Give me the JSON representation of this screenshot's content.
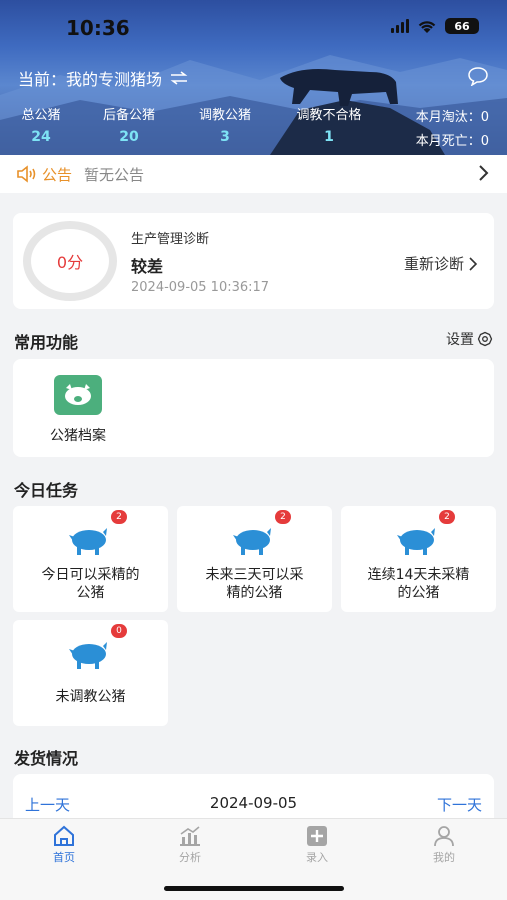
{
  "status": {
    "time": "10:36",
    "battery": "66"
  },
  "header": {
    "farm_prefix": "当前：",
    "farm_name": "我的专测猪场"
  },
  "stats": [
    {
      "label": "总公猪",
      "value": "24"
    },
    {
      "label": "后备公猪",
      "value": "20"
    },
    {
      "label": "调教公猪",
      "value": "3"
    },
    {
      "label": "调教不合格",
      "value": "1"
    }
  ],
  "month": {
    "culled": "本月淘汰：0",
    "dead": "本月死亡：0"
  },
  "notice": {
    "tag": "公告",
    "text": "暂无公告"
  },
  "diagnosis": {
    "score": "0分",
    "title": "生产管理诊断",
    "level": "较差",
    "time": "2024-09-05 10:36:17",
    "action": "重新诊断"
  },
  "common": {
    "title": "常用功能",
    "setting": "设置",
    "items": [
      {
        "label": "公猪档案"
      }
    ]
  },
  "tasks": {
    "title": "今日任务",
    "items": [
      {
        "badge": "2",
        "line1": "今日可以采精的",
        "line2": "公猪"
      },
      {
        "badge": "2",
        "line1": "未来三天可以采",
        "line2": "精的公猪"
      },
      {
        "badge": "2",
        "line1": "连续14天未采精",
        "line2": "的公猪"
      },
      {
        "badge": "0",
        "line1": "未调教公猪",
        "line2": ""
      }
    ]
  },
  "shipping": {
    "title": "发货情况",
    "prev": "上一天",
    "date": "2024-09-05",
    "next": "下一天"
  },
  "tabbar": [
    {
      "label": "首页"
    },
    {
      "label": "分析"
    },
    {
      "label": "录入"
    },
    {
      "label": "我的"
    }
  ],
  "colors": {
    "accent": "#2f73d9",
    "stat_value": "#7ee3f5",
    "badge": "#e53b3b",
    "notice": "#e8912a"
  }
}
